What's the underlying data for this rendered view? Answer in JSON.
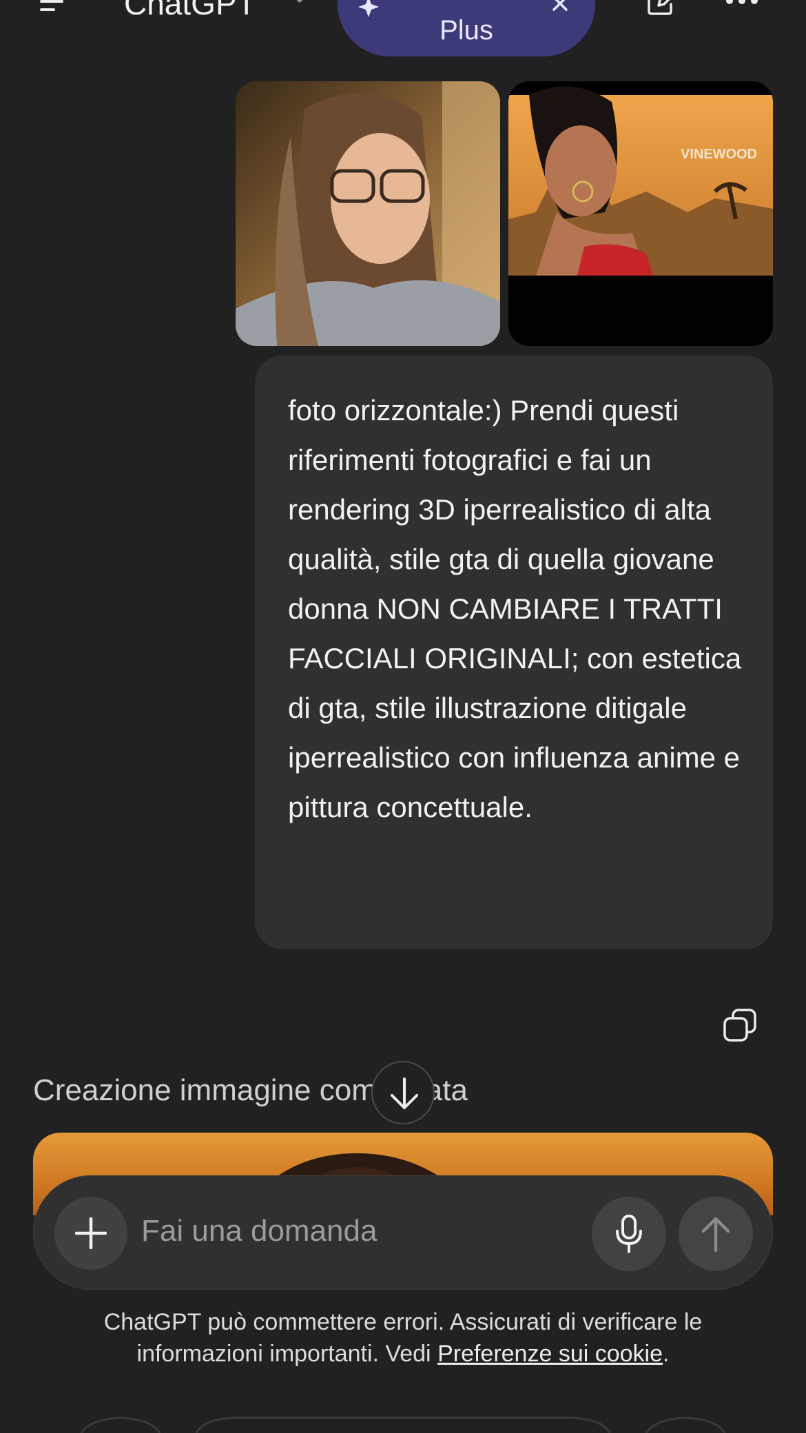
{
  "header": {
    "app_title": "ChatGPT",
    "upgrade_label": "Plus",
    "icons": [
      "menu-icon",
      "chevron-down-icon",
      "sparkle-icon",
      "close-icon",
      "edit-icon",
      "more-icon"
    ]
  },
  "conversation": {
    "user_images": [
      "photo-reference",
      "gta-style-reference"
    ],
    "user_message": "foto orizzontale:) Prendi questi riferimenti fotografici e fai un rendering 3D iperrealistico di alta qualità, stile gta di quella giovane donna NON CAMBIARE I TRATTI FACCIALI ORIGINALI; con estetica di gta, stile illustrazione ditigale iperrealistico con influenza anime e pittura concettuale.",
    "gta_logo_text": "VINEWOOD",
    "status": "Creazione immagine completata"
  },
  "composer": {
    "placeholder": "Fai una domanda"
  },
  "footer": {
    "disclaimer_text": "ChatGPT può commettere errori. Assicurati di verificare le informazioni importanti. Vedi ",
    "cookie_link": "Preferenze sui cookie",
    "disclaimer_end": "."
  },
  "colors": {
    "background": "#212121",
    "bubble": "#303030",
    "upgrade_pill": "#3c3a78",
    "text": "#ececec"
  }
}
